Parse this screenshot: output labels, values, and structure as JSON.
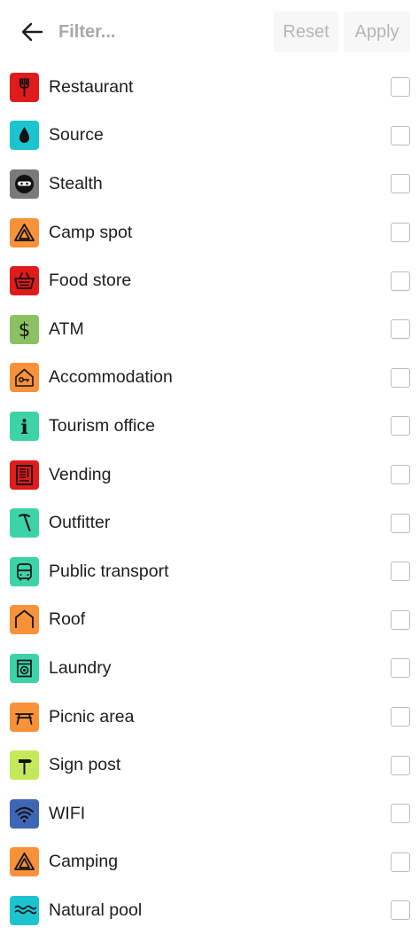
{
  "header": {
    "filter_placeholder": "Filter...",
    "reset_label": "Reset",
    "apply_label": "Apply"
  },
  "items": [
    {
      "label": "Restaurant",
      "color": "#e01b1b",
      "icon": "fork-icon"
    },
    {
      "label": "Source",
      "color": "#1cc3d0",
      "icon": "water-drop-icon"
    },
    {
      "label": "Stealth",
      "color": "#7a7a7a",
      "icon": "ninja-icon"
    },
    {
      "label": "Camp spot",
      "color": "#f7923a",
      "icon": "tent-icon"
    },
    {
      "label": "Food store",
      "color": "#e01b1b",
      "icon": "basket-icon"
    },
    {
      "label": "ATM",
      "color": "#8bc163",
      "icon": "dollar-icon"
    },
    {
      "label": "Accommodation",
      "color": "#f7923a",
      "icon": "house-key-icon"
    },
    {
      "label": "Tourism office",
      "color": "#3dd3a8",
      "icon": "info-icon"
    },
    {
      "label": "Vending",
      "color": "#e01b1b",
      "icon": "vending-machine-icon"
    },
    {
      "label": "Outfitter",
      "color": "#3dd3a8",
      "icon": "pickaxe-icon"
    },
    {
      "label": "Public transport",
      "color": "#3dd3a8",
      "icon": "bus-icon"
    },
    {
      "label": "Roof",
      "color": "#f7923a",
      "icon": "roof-icon"
    },
    {
      "label": "Laundry",
      "color": "#3dd3a8",
      "icon": "washing-machine-icon"
    },
    {
      "label": "Picnic area",
      "color": "#f7923a",
      "icon": "picnic-table-icon"
    },
    {
      "label": "Sign post",
      "color": "#c5e85a",
      "icon": "signpost-icon"
    },
    {
      "label": "WIFI",
      "color": "#3f66b5",
      "icon": "wifi-icon"
    },
    {
      "label": "Camping",
      "color": "#f7923a",
      "icon": "tent-icon"
    },
    {
      "label": "Natural pool",
      "color": "#1cc3d0",
      "icon": "waves-icon"
    }
  ]
}
